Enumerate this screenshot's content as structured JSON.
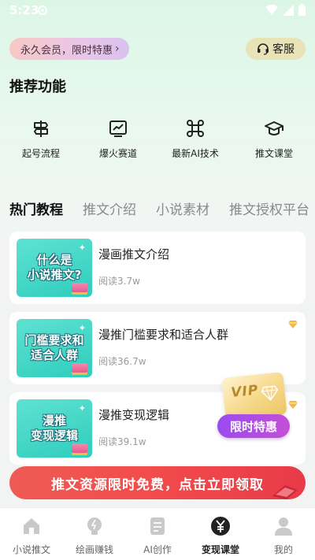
{
  "status_bar": {
    "time": "5:23"
  },
  "header": {
    "vip_pill_label": "永久会员，限时特惠",
    "service_label": "客服"
  },
  "recommend": {
    "title": "推荐功能",
    "items": [
      {
        "label": "起号流程",
        "icon": "signpost-icon"
      },
      {
        "label": "爆火赛道",
        "icon": "trend-chart-icon"
      },
      {
        "label": "最新AI技术",
        "icon": "command-icon"
      },
      {
        "label": "推文课堂",
        "icon": "graduation-cap-icon"
      }
    ]
  },
  "tabs": [
    {
      "label": "热门教程",
      "active": true
    },
    {
      "label": "推文介绍",
      "active": false
    },
    {
      "label": "小说素材",
      "active": false
    },
    {
      "label": "推文授权平台",
      "active": false
    }
  ],
  "articles": [
    {
      "thumb_lines": [
        "什么是",
        "小说推文?"
      ],
      "title": "漫画推文介绍",
      "reads": "阅读3.7w",
      "premium": false
    },
    {
      "thumb_lines": [
        "门槛要求和",
        "适合人群"
      ],
      "title": "漫推门槛要求和适合人群",
      "reads": "阅读36.7w",
      "premium": true
    },
    {
      "thumb_lines": [
        "漫推",
        "变现逻辑"
      ],
      "title": "漫推变现逻辑",
      "reads": "阅读39.1w",
      "premium": true
    }
  ],
  "vip_float": {
    "vip_text": "VIP",
    "limited_label": "限时特惠"
  },
  "promo_banner": {
    "label": "推文资源限时免费，点击立即领取"
  },
  "bottom_nav": [
    {
      "label": "小说推文",
      "icon": "home-icon",
      "active": false
    },
    {
      "label": "绘画赚钱",
      "icon": "lightbulb-icon",
      "active": false
    },
    {
      "label": "AI创作",
      "icon": "document-icon",
      "active": false
    },
    {
      "label": "变现课堂",
      "icon": "yen-icon",
      "active": true
    },
    {
      "label": "我的",
      "icon": "person-icon",
      "active": false
    }
  ],
  "colors": {
    "accent_green": "#2fcdbd",
    "promo_red": "#f24b4b",
    "vip_purple": "#9b4bf0"
  }
}
